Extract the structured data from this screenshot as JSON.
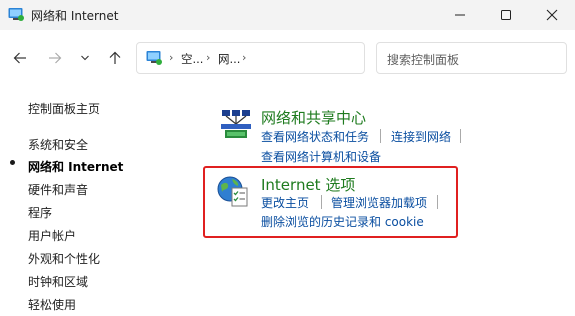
{
  "window": {
    "title": "网络和 Internet"
  },
  "navbar": {
    "address_segments": [
      "空...",
      "网..."
    ],
    "search_placeholder": "搜索控制面板"
  },
  "sidebar": {
    "home": "控制面板主页",
    "items": [
      {
        "label": "系统和安全"
      },
      {
        "label": "网络和 Internet",
        "active": true
      },
      {
        "label": "硬件和声音"
      },
      {
        "label": "程序"
      },
      {
        "label": "用户帐户"
      },
      {
        "label": "外观和个性化"
      },
      {
        "label": "时钟和区域"
      },
      {
        "label": "轻松使用"
      }
    ]
  },
  "main": {
    "categories": [
      {
        "icon": "network-sharing-center-icon",
        "title": "网络和共享中心",
        "links": [
          "查看网络状态和任务",
          "连接到网络",
          "查看网络计算机和设备"
        ]
      },
      {
        "icon": "internet-options-icon",
        "title": "Internet 选项",
        "links": [
          "更改主页",
          "管理浏览器加载项",
          "删除浏览的历史记录和 cookie"
        ]
      }
    ]
  },
  "colors": {
    "category_title": "#1e7b1e",
    "link": "#0a4ea0",
    "highlight_border": "#e02020",
    "titlebar_bg": "#f3f3f3"
  }
}
